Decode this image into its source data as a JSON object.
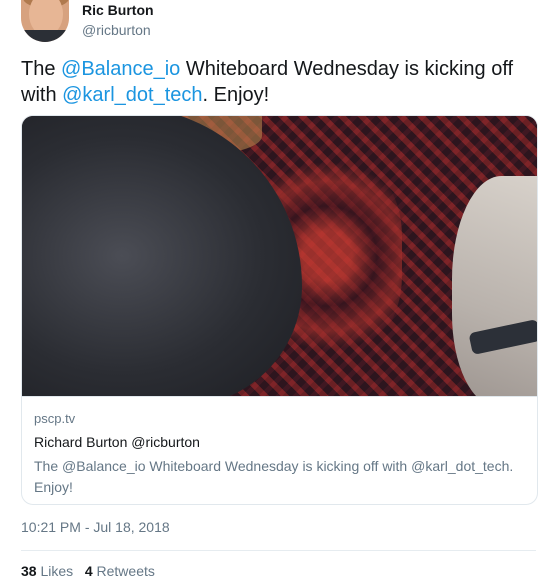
{
  "author": {
    "display_name": "Ric Burton",
    "handle": "@ricburton"
  },
  "tweet": {
    "text_parts": {
      "t1": "The ",
      "m1": "@Balance_io",
      "t2": " Whiteboard Wednesday is kicking off with ",
      "m2": "@karl_dot_tech",
      "t3": ". Enjoy!"
    }
  },
  "card": {
    "domain": "pscp.tv",
    "title": "Richard Burton @ricburton",
    "description": "The @Balance_io Whiteboard Wednesday is kicking off with @karl_dot_tech. Enjoy!"
  },
  "timestamp": "10:21 PM - Jul 18, 2018",
  "stats": {
    "likes_count": "38",
    "likes_label": "Likes",
    "retweets_count": "4",
    "retweets_label": "Retweets"
  },
  "colors": {
    "mention": "#1b95e0",
    "secondary_text": "#657786",
    "border": "#e1e8ed"
  }
}
